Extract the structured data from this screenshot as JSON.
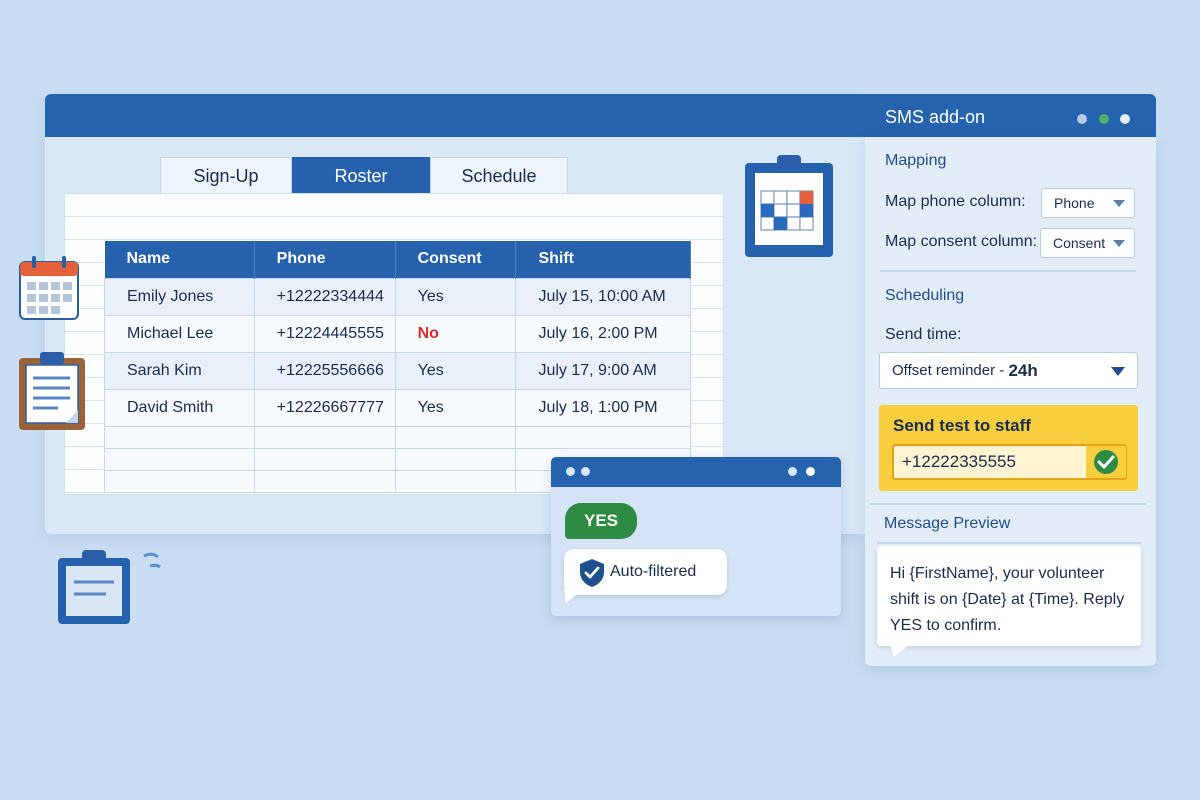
{
  "tabs": [
    {
      "label": "Sign-Up",
      "active": false
    },
    {
      "label": "Roster",
      "active": true
    },
    {
      "label": "Schedule",
      "active": false
    }
  ],
  "roster": {
    "columns": [
      "Name",
      "Phone",
      "Consent",
      "Shift"
    ],
    "rows": [
      {
        "name": "Emily Jones",
        "phone": "+12222334444",
        "consent": "Yes",
        "shift": "July 15, 10:00 AM"
      },
      {
        "name": "Michael Lee",
        "phone": "+12224445555",
        "consent": "No",
        "shift": "July 16, 2:00 PM"
      },
      {
        "name": "Sarah Kim",
        "phone": "+12225556666",
        "consent": "Yes",
        "shift": "July 17, 9:00 AM"
      },
      {
        "name": "David Smith",
        "phone": "+12226667777",
        "consent": "Yes",
        "shift": "July 18, 1:00 PM"
      }
    ]
  },
  "sms_panel": {
    "title": "SMS add-on",
    "mapping": {
      "section_title": "Mapping",
      "phone_label": "Map phone column:",
      "phone_value": "Phone",
      "consent_label": "Map consent column:",
      "consent_value": "Consent"
    },
    "scheduling": {
      "section_title": "Scheduling",
      "send_time_label": "Send time:",
      "send_time_prefix": "Offset reminder - ",
      "send_time_value": "24h"
    },
    "send_test": {
      "label": "Send test to staff",
      "phone": "+12222335555"
    },
    "preview": {
      "section_title": "Message Preview",
      "message": "Hi {FirstName}, your volunteer shift is on {Date} at {Time}. Reply YES to confirm."
    }
  },
  "chat": {
    "reply": "YES",
    "status": "Auto-filtered"
  },
  "colors": {
    "primary": "#2561ad",
    "consent_no": "#d32f2f",
    "yes_green": "#2e8b43",
    "test_yellow": "#f7cf3e"
  },
  "icons": [
    "calendar-icon",
    "clipboard-icon",
    "clipboard-calendar-icon",
    "shield-check-icon",
    "check-circle-icon",
    "window-dots-icon"
  ]
}
